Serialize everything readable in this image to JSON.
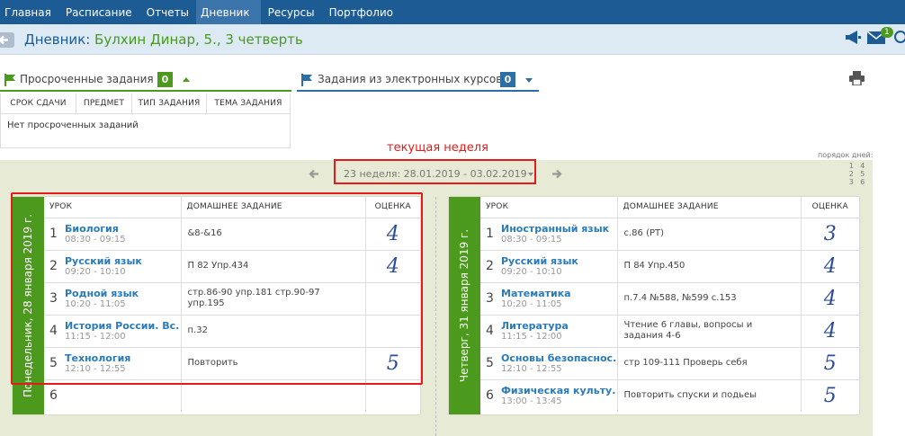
{
  "nav": {
    "items": [
      "Главная",
      "Расписание",
      "Отчеты",
      "Дневник",
      "Ресурсы",
      "Портфолио"
    ],
    "active_index": 3
  },
  "header": {
    "title_prefix": "Дневник:",
    "title_name": "Булхин Динар, 5., 3 четверть",
    "mail_count": "1"
  },
  "overdue": {
    "label": "Просроченные задания",
    "count": "0",
    "columns": [
      "СРОК СДАЧИ",
      "ПРЕДМЕТ",
      "ТИП ЗАДАНИЯ",
      "ТЕМА ЗАДАНИЯ"
    ],
    "empty": "Нет просроченных заданий"
  },
  "ecourses": {
    "label": "Задания из электронных курсов",
    "count": "0"
  },
  "annotation": {
    "current_week": "текущая неделя"
  },
  "week": {
    "label": "23 неделя: 28.01.2019 - 03.02.2019",
    "day_order_label": "порядок дней:",
    "day_order": [
      "1",
      "4",
      "2",
      "5",
      "3",
      "6"
    ]
  },
  "columns": {
    "lesson": "УРОК",
    "homework": "ДОМАШНЕЕ ЗАДАНИЕ",
    "grade": "ОЦЕНКА"
  },
  "colors": {
    "nav": "#1c5b94",
    "accent_green": "#4c9a1d",
    "link": "#2a7ab8",
    "highlight": "#e41b1b"
  },
  "days": [
    {
      "title": "Понедельник, 28 января 2019 г.",
      "lessons": [
        {
          "num": "1",
          "subject": "Биология",
          "time": "08:30 - 09:15",
          "homework": "&8-&16",
          "grade": "4"
        },
        {
          "num": "2",
          "subject": "Русский язык",
          "time": "09:20 - 10:10",
          "homework": "П 82 Упр.434",
          "grade": "4"
        },
        {
          "num": "3",
          "subject": "Родной язык",
          "time": "10:20 - 11:05",
          "homework": "стр.86-90 упр.181 стр.90-97 упр.195",
          "grade": ""
        },
        {
          "num": "4",
          "subject": "История России. Вс...",
          "time": "11:15 - 12:00",
          "homework": "п.32",
          "grade": ""
        },
        {
          "num": "5",
          "subject": "Технология",
          "time": "12:10 - 12:55",
          "homework": "Повторить",
          "grade": "5"
        },
        {
          "num": "6",
          "subject": "",
          "time": "",
          "homework": "",
          "grade": ""
        }
      ]
    },
    {
      "title": "Четверг, 31 января 2019 г.",
      "lessons": [
        {
          "num": "1",
          "subject": "Иностранный язык",
          "time": "08:30 - 09:15",
          "homework": "с.86 (РТ)",
          "grade": "3"
        },
        {
          "num": "2",
          "subject": "Русский язык",
          "time": "09:20 - 10:10",
          "homework": "П 84 Упр.450",
          "grade": "4"
        },
        {
          "num": "3",
          "subject": "Математика",
          "time": "10:20 - 11:05",
          "homework": "п.7.4 №588, №599 с.153",
          "grade": "4"
        },
        {
          "num": "4",
          "subject": "Литература",
          "time": "11:15 - 12:00",
          "homework": "Чтение 6 главы, вопросы и задания 4-6",
          "grade": "4"
        },
        {
          "num": "5",
          "subject": "Основы безопаснос...",
          "time": "12:10 - 12:55",
          "homework": "стр 109-111 Проверь себя",
          "grade": "5"
        },
        {
          "num": "6",
          "subject": "Физическая культу...",
          "time": "13:00 - 13:45",
          "homework": "Повторить спуски и подьеы",
          "grade": "5"
        }
      ]
    }
  ]
}
